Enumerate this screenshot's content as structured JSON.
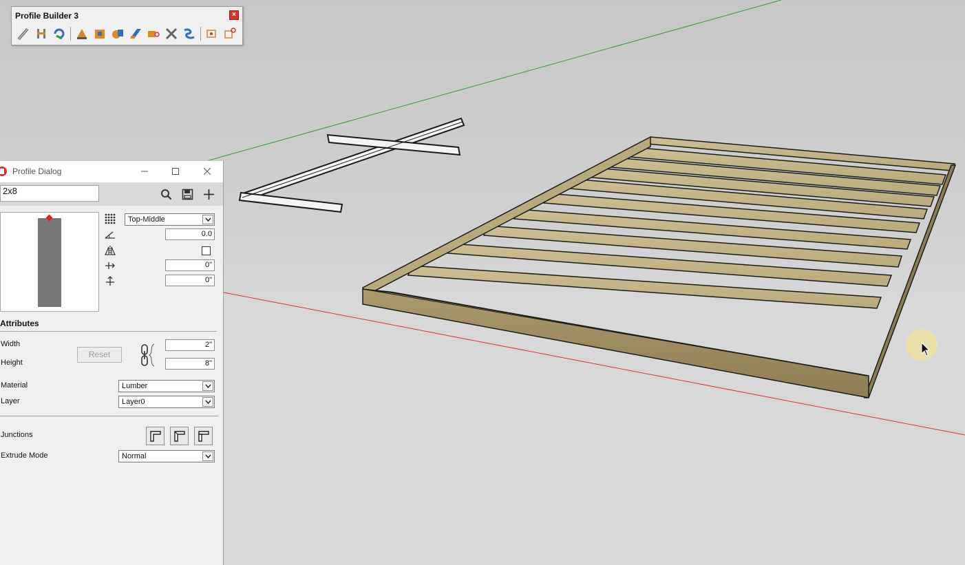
{
  "toolbar": {
    "title": "Profile Builder 3",
    "close_glyph": "×",
    "tools": [
      "profile-path-icon",
      "build-member-icon",
      "rebuild-icon",
      "paint-profile-icon",
      "extrude-icon",
      "assembly-icon",
      "stretch-icon",
      "split-icon",
      "tag-icon",
      "cut-icon",
      "smart-path-icon",
      "component-icon",
      "assembly-edit-icon"
    ]
  },
  "dialog": {
    "title": "Profile Dialog",
    "profile_name": "2x8",
    "alignment": "Top-Middle",
    "rotation": "0.0",
    "offset_x": "0\"",
    "offset_y": "0\"",
    "attributes_heading": "Attributes",
    "width_label": "Width",
    "width_value": "2\"",
    "height_label": "Height",
    "height_value": "8\"",
    "reset_label": "Reset",
    "material_label": "Material",
    "material_value": "Lumber",
    "layer_label": "Layer",
    "layer_value": "Layer0",
    "junctions_label": "Junctions",
    "extrude_mode_label": "Extrude Mode",
    "extrude_mode_value": "Normal"
  },
  "colors": {
    "axis_green": "#2e9e2e",
    "axis_red": "#e03030",
    "lumber_light": "#c8b98a",
    "lumber_dark": "#8a7a4e",
    "profile_marker": "#e02020"
  }
}
